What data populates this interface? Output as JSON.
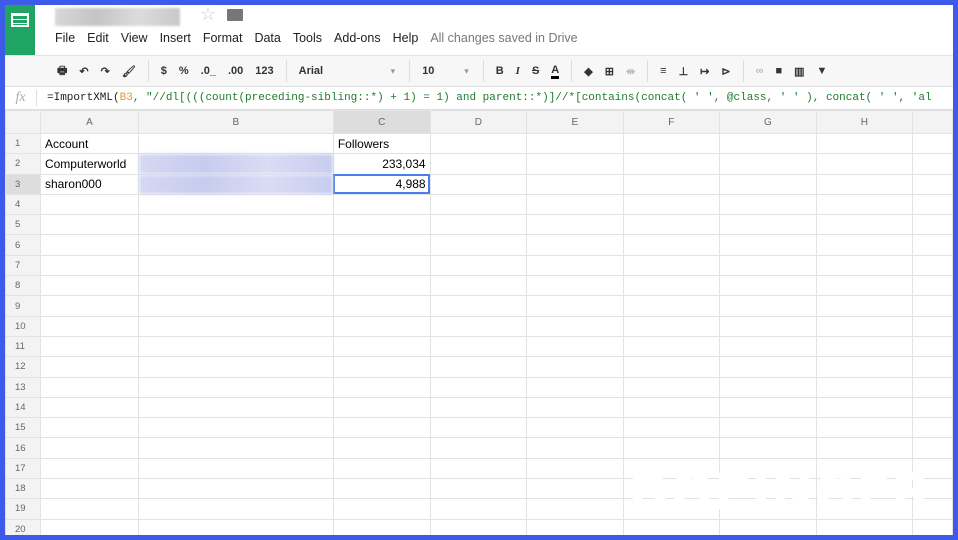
{
  "menu": [
    "File",
    "Edit",
    "View",
    "Insert",
    "Format",
    "Data",
    "Tools",
    "Add-ons",
    "Help"
  ],
  "save_status": "All changes saved in Drive",
  "toolbar": {
    "currency": "$",
    "percent": "%",
    "dec_less": ".0_",
    "dec_more": ".00",
    "format": "123",
    "font": "Arial",
    "size": "10",
    "bold": "B",
    "italic": "I",
    "strike": "S",
    "text_color": "A"
  },
  "formula": {
    "fx": "fx",
    "prefix": "=ImportXML(",
    "ref": "B3",
    "rest": ", \"//dl[(((count(preceding-sibling::*) + 1) = 1) and parent::*)]//*[contains(concat( ' ', @class, ' ' ), concat( ' ', 'al"
  },
  "columns": [
    "A",
    "B",
    "C",
    "D",
    "E",
    "F",
    "G",
    "H"
  ],
  "rows": [
    {
      "n": "1",
      "a": "Account",
      "b": "",
      "c": "Followers"
    },
    {
      "n": "2",
      "a": "Computerworld",
      "b": "",
      "c": "233,034"
    },
    {
      "n": "3",
      "a": "sharon000",
      "b": "",
      "c": "4,988"
    },
    {
      "n": "4"
    },
    {
      "n": "5"
    },
    {
      "n": "6"
    },
    {
      "n": "7"
    },
    {
      "n": "8"
    },
    {
      "n": "9"
    },
    {
      "n": "10"
    },
    {
      "n": "11"
    },
    {
      "n": "12"
    },
    {
      "n": "13"
    },
    {
      "n": "14"
    },
    {
      "n": "15"
    },
    {
      "n": "16"
    },
    {
      "n": "17"
    },
    {
      "n": "18"
    },
    {
      "n": "19"
    },
    {
      "n": "20"
    }
  ],
  "watermark": "DOPINGER"
}
